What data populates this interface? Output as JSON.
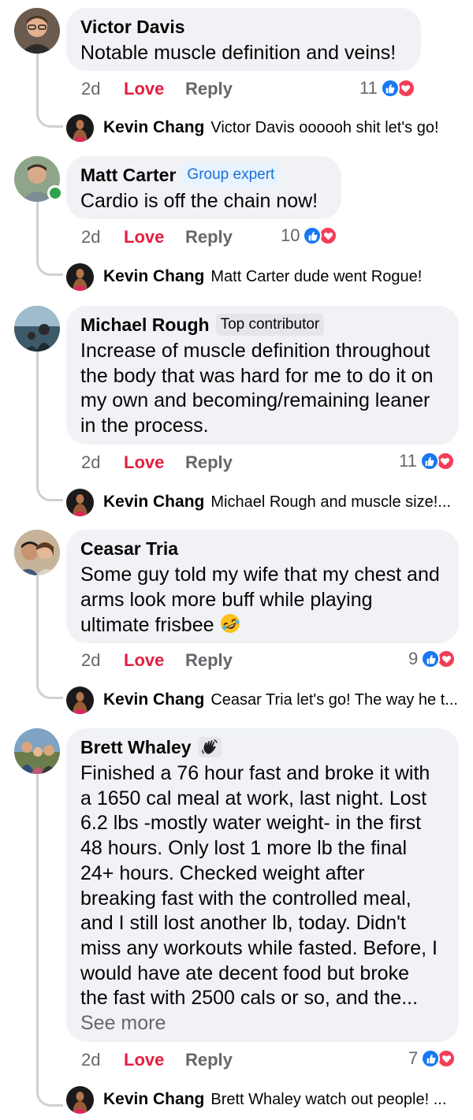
{
  "comments": [
    {
      "author": "Victor Davis",
      "badge": "",
      "text": "Notable muscle definition and veins!",
      "time": "2d",
      "love_label": "Love",
      "reply_label": "Reply",
      "reaction_count": "11",
      "reply": {
        "author": "Kevin Chang",
        "text": "Victor Davis oooooh shit let's go!"
      }
    },
    {
      "author": "Matt Carter",
      "badge": "Group expert",
      "text": "Cardio is off the chain now!",
      "time": "2d",
      "love_label": "Love",
      "reply_label": "Reply",
      "reaction_count": "10",
      "reply": {
        "author": "Kevin Chang",
        "text": "Matt Carter dude went Rogue!"
      }
    },
    {
      "author": "Michael Rough",
      "badge": "Top contributor",
      "text": "Increase of muscle definition throughout\nthe body that was hard for me to do it on\nmy own and becoming/remaining leaner\nin the process.",
      "time": "2d",
      "love_label": "Love",
      "reply_label": "Reply",
      "reaction_count": "11",
      "reply": {
        "author": "Kevin Chang",
        "text": "Michael Rough and muscle size!..."
      }
    },
    {
      "author": "Ceasar Tria",
      "badge": "",
      "text": "Some guy told my wife that my chest and\narms look more buff while playing\nultimate frisbee",
      "emoji": "rolling-on-floor-laughing-emoji",
      "time": "2d",
      "love_label": "Love",
      "reply_label": "Reply",
      "reaction_count": "9",
      "reply": {
        "author": "Kevin Chang",
        "text": "Ceasar Tria let's go! The way he t..."
      }
    },
    {
      "author": "Brett Whaley",
      "badge_icon": "waving-hand-icon",
      "text": "Finished a 76 hour fast and broke it with\na 1650 cal meal at work, last night. Lost\n6.2 lbs -mostly water weight- in the first\n48 hours. Only lost 1 more lb the final\n24+ hours. Checked weight after\nbreaking fast with the controlled meal,\nand I still lost another lb, today. Didn't\nmiss any workouts while fasted. Before, I\nwould have ate decent food but broke\nthe fast with 2500 cals or so, and the...",
      "see_more": "See more",
      "time": "2d",
      "love_label": "Love",
      "reply_label": "Reply",
      "reaction_count": "7",
      "reply": {
        "author": "Kevin Chang",
        "text": "Brett Whaley watch out people! ..."
      }
    }
  ],
  "colors": {
    "bubble": "#f0f2f5",
    "love": "#e41e3f",
    "muted": "#65676b",
    "like_blue": "#1877f2",
    "heart_red": "#f33e58",
    "expert_badge": "#1d6fd8"
  }
}
